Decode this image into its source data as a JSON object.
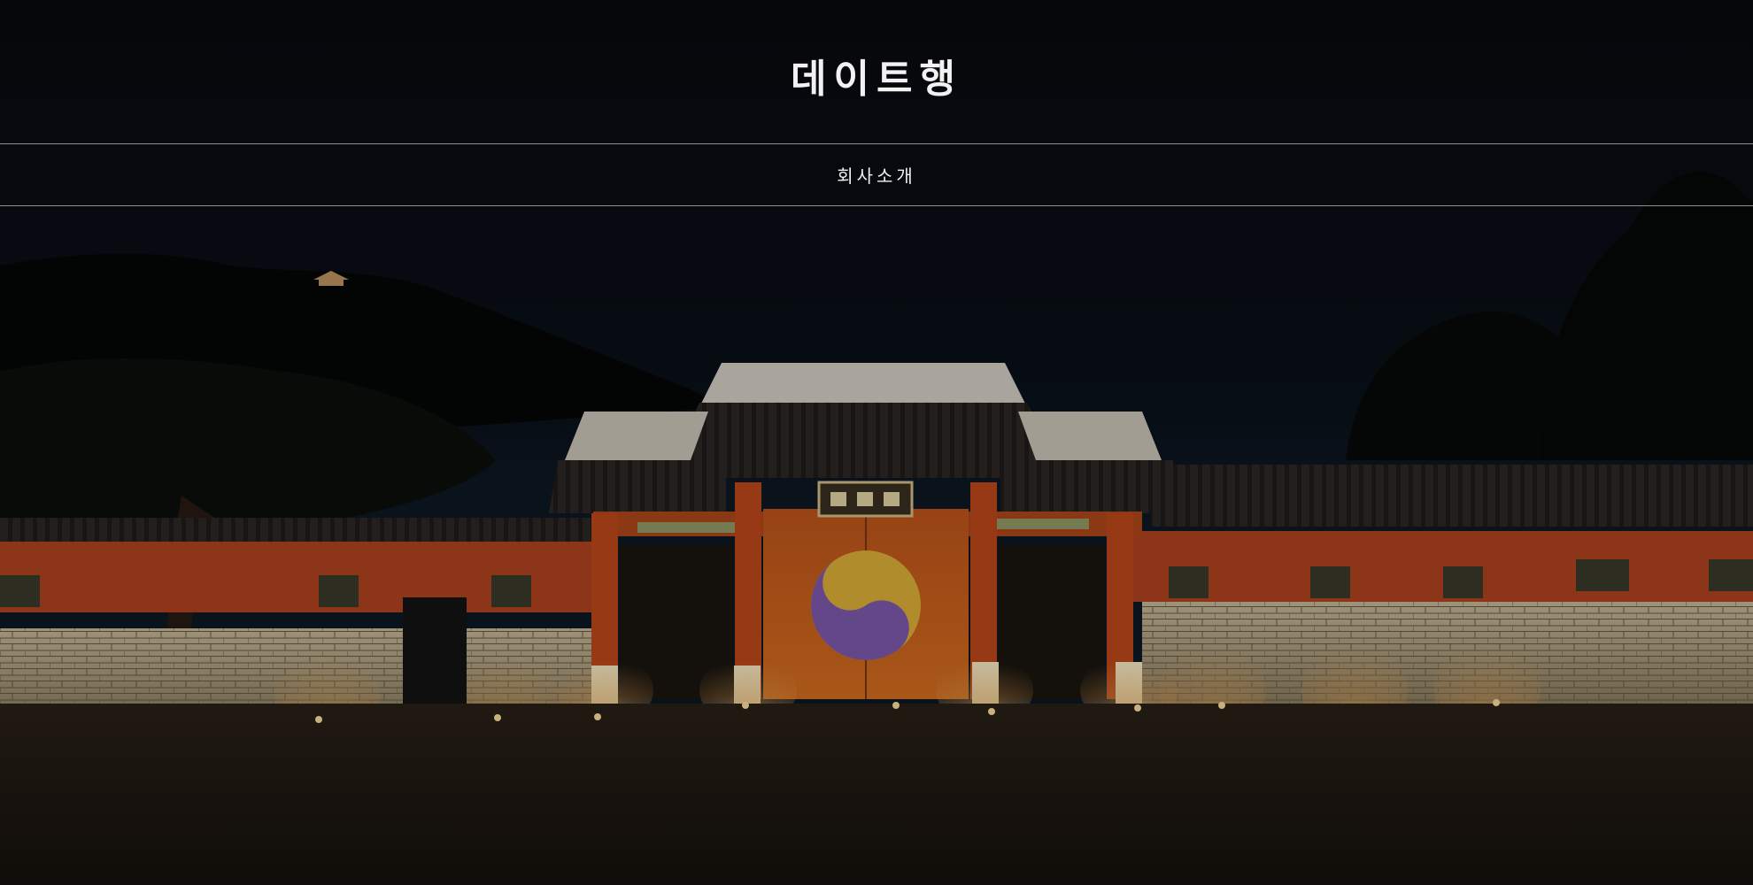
{
  "header": {
    "site_title": "데이트행"
  },
  "nav": {
    "items": [
      {
        "label": "회사소개"
      }
    ]
  },
  "colors": {
    "background": "#070a0e",
    "sky": "#0a1420",
    "wall_red": "#c04a22",
    "gate_orange": "#d8621e",
    "light_glow": "#ffd27a",
    "text": "#f2f2f2"
  }
}
